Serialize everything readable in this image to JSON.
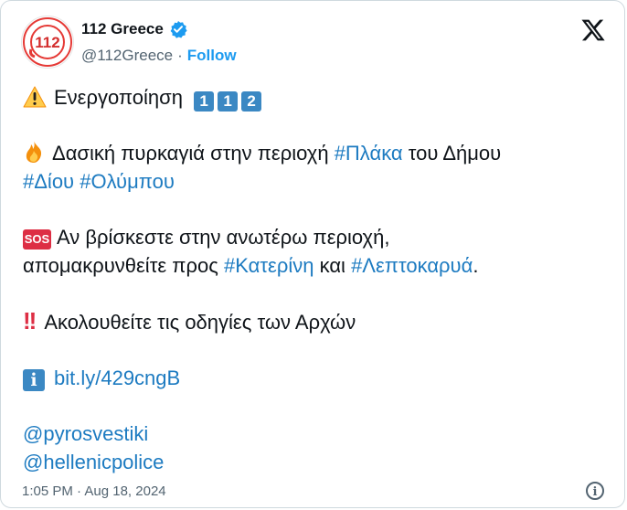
{
  "account": {
    "name": "112 Greece",
    "handle": "@112Greece",
    "separator": "·",
    "follow_label": "Follow",
    "verified_color": "#1d9bf0",
    "avatar_text": "112",
    "avatar_ring_text": "ΕΥΡΩΠΑΪΚΟΣ ΑΡΙΘΜΟΣ ΕΚΤΑΚΤΟΥ ΑΝΑΓΚΗΣ"
  },
  "tweet": {
    "line1_text": "Ενεργοποίηση",
    "keycaps": [
      "1",
      "1",
      "2"
    ],
    "line2_text": "Δασική πυρκαγιά στην περιοχή",
    "line2_tag": "#Πλάκα",
    "line2_text_after": "του Δήμου",
    "line3_tag1": "#Δίου",
    "line3_tag2": "#Ολύμπου",
    "sos_label": "SOS",
    "line4_text": "Αν βρίσκεστε στην ανωτέρω περιοχή,",
    "line5_text": "απομακρυνθείτε προς",
    "line5_tag1": "#Κατερίνη",
    "line5_mid": "και",
    "line5_tag2": "#Λεπτοκαρυά",
    "line5_end": ".",
    "bang": "!!",
    "line6_text": "Ακολουθείτε τις οδηγίες των Αρχών",
    "info_glyph": "i",
    "link": "bit.ly/429cngB",
    "mention1": "@pyrosvestiki",
    "mention2": "@hellenicpolice"
  },
  "footer": {
    "time": "1:05 PM",
    "separator": "·",
    "date": "Aug 18, 2024",
    "info_glyph": "i"
  },
  "colors": {
    "link": "#1d7bc1",
    "text": "#0f1419",
    "muted": "#536471",
    "accent_red": "#dd2e44",
    "keycap_blue": "#3b88c3"
  }
}
